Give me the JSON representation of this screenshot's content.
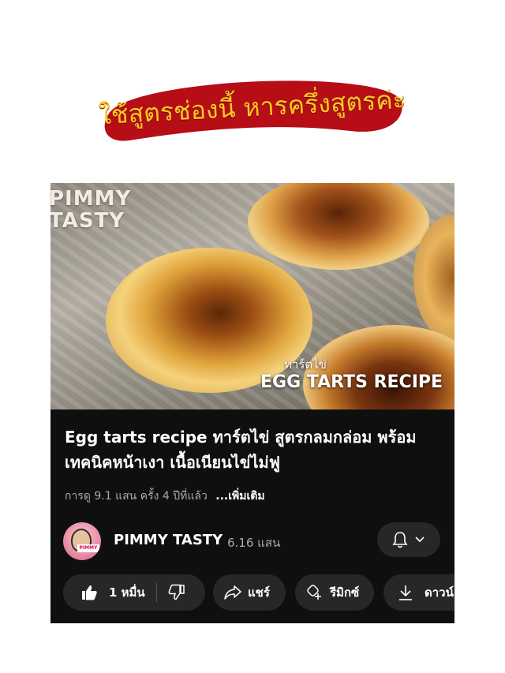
{
  "banner": {
    "text": "ใช้สูตรช่องนี้ หารครึ่งสูตรค่ะ",
    "bg_color": "#b60d16",
    "text_color": "#f6cc22"
  },
  "thumbnail": {
    "brand_line1": "PIMMY",
    "brand_line2": "TASTY",
    "sub_text": "ทาร์ตไข่",
    "title_text": "EGG TARTS RECIPE"
  },
  "video": {
    "title": "Egg tarts recipe ทาร์ตไข่ สูตรกลมกล่อม พร้อมเทคนิคหน้าเงา เนื้อเนียนไข่ไม่ฟู",
    "meta": "การดู 9.1 แสน ครั้ง  4 ปีที่แล้ว",
    "more": "...เพิ่มเติม"
  },
  "channel": {
    "name": "PIMMY TASTY",
    "subscribers": "6.16 แสน",
    "avatar_tag": "PIMMY"
  },
  "actions": {
    "likes": "1 หมื่น",
    "share": "แชร์",
    "remix": "รีมิกซ์",
    "download": "ดาวน์"
  },
  "icons": {
    "bell": "bell-icon",
    "chevron": "chevron-down-icon",
    "like": "thumbs-up-icon",
    "dislike": "thumbs-down-icon",
    "share": "share-arrow-icon",
    "remix": "remix-icon",
    "download": "download-icon"
  }
}
